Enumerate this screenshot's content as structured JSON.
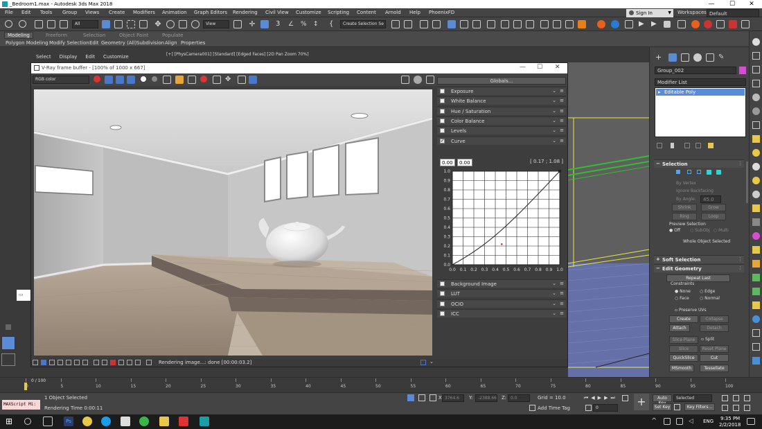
{
  "window": {
    "title": "_Bedroom1.max - Autodesk 3ds Max 2018",
    "min": "—",
    "max": "☐",
    "close": "✕"
  },
  "menu": [
    "File",
    "Edit",
    "Tools",
    "Group",
    "Views",
    "Create",
    "Modifiers",
    "Animation",
    "Graph Editors",
    "Rendering",
    "Civil View",
    "Customize",
    "Scripting",
    "Content",
    "Arnold",
    "Help",
    "PhoenixFD"
  ],
  "signin": {
    "label": "Sign In",
    "arrow": "▼"
  },
  "workspaces": {
    "label": "Workspaces:",
    "value": "Default"
  },
  "toolbar": {
    "filter": "All",
    "view": "View",
    "selection_set": "Create Selection Se"
  },
  "ribbon": {
    "tabs": [
      "Modeling",
      "Freeform",
      "Selection",
      "Object Paint",
      "Populate"
    ],
    "subtabs": [
      "Polygon Modeling",
      "Modify Selection",
      "Edit",
      "Geometry (All)",
      "Subdivision",
      "Align",
      "Properties"
    ]
  },
  "viewport": {
    "menu": [
      "Select",
      "Display",
      "Edit",
      "Customize"
    ],
    "label": "[+] [PhysCamera001] [Standard] [Edged Faces] [2D Pan Zoom 70%]"
  },
  "vfb": {
    "title": "V-Ray frame buffer - [100% of 1000 x 667]",
    "channel": "RGB color",
    "globals": "Globals...",
    "layers_top": [
      {
        "label": "Exposure",
        "checked": false
      },
      {
        "label": "White Balance",
        "checked": false
      },
      {
        "label": "Hue / Saturation",
        "checked": false
      },
      {
        "label": "Color Balance",
        "checked": false
      },
      {
        "label": "Levels",
        "checked": false
      },
      {
        "label": "Curve",
        "checked": true
      }
    ],
    "curve": {
      "in1": "0.00",
      "in2": "0.00",
      "coord": "[ 0.17 ; 1.08 ]",
      "yticks": [
        "1.0",
        "0.9",
        "0.8",
        "0.7",
        "0.6",
        "0.5",
        "0.4",
        "0.3",
        "0.2",
        "0.1",
        "0.0"
      ],
      "xticks": [
        "0.0",
        "0.1",
        "0.2",
        "0.3",
        "0.4",
        "0.5",
        "0.6",
        "0.7",
        "0.8",
        "0.9",
        "1.0"
      ]
    },
    "layers_bottom": [
      {
        "label": "Background Image",
        "checked": false
      },
      {
        "label": "LUT",
        "checked": false
      },
      {
        "label": "OCIO",
        "checked": false
      },
      {
        "label": "ICC",
        "checked": false
      }
    ],
    "status": "Rendering image...: done [00:00:03.2]"
  },
  "command": {
    "object_name": "Group_002",
    "modifier_list": "Modifier List",
    "stack_item": "Editable Poly",
    "selection": {
      "title": "Selection",
      "by_vertex": "By Vertex",
      "ignore_backfacing": "Ignore Backfacing",
      "by_angle": "By Angle:",
      "angle_val": "45.0",
      "shrink": "Shrink",
      "grow": "Grow",
      "ring": "Ring",
      "loop": "Loop",
      "preview": "Preview Selection",
      "off": "Off",
      "subobj": "SubObj",
      "multi": "Multi",
      "whole": "Whole Object Selected"
    },
    "soft": "Soft Selection",
    "edit_geometry": {
      "title": "Edit Geometry",
      "repeat": "Repeat Last",
      "constraints": "Constraints",
      "none": "None",
      "edge": "Edge",
      "face": "Face",
      "normal": "Normal",
      "preserve_uvs": "Preserve UVs",
      "create": "Create",
      "collapse": "Collapse",
      "attach": "Attach",
      "detach": "Detach",
      "slice_plane": "Slice Plane",
      "split": "Split",
      "slice": "Slice",
      "reset_plane": "Reset Plane",
      "quickslice": "QuickSlice",
      "cut": "Cut",
      "msmooth": "MSmooth",
      "tessellate": "Tessellate"
    }
  },
  "timeline": {
    "frame": "0 / 100",
    "ticks": [
      "0",
      "5",
      "10",
      "15",
      "20",
      "25",
      "30",
      "35",
      "40",
      "45",
      "50",
      "55",
      "60",
      "65",
      "70",
      "75",
      "80",
      "85",
      "90",
      "95",
      "100"
    ]
  },
  "statusbar": {
    "maxscript": "MAXScript Mi:",
    "selected": "1 Object Selected",
    "render_time": "Rendering Time 0:00:11",
    "x_label": "X:",
    "x": "3764.6",
    "y_label": "Y:",
    "y": "-2388.666",
    "z_label": "Z:",
    "z": "0.0",
    "grid": "Grid = 10.0",
    "add_time_tag": "Add Time Tag",
    "auto_key": "Auto Key",
    "set_key": "Set Key",
    "selected_drop": "Selected",
    "key_filters": "Key Filters...",
    "frame_field": "0"
  },
  "taskbar": {
    "lang": "ENG",
    "time": "9:35 PM",
    "date": "2/2/2018"
  },
  "colors": {
    "accent": "#5b8ad6",
    "ps": "#2b3d6b",
    "yellow_wire": "#e8e84a",
    "green_wire": "#2fbf2f"
  }
}
